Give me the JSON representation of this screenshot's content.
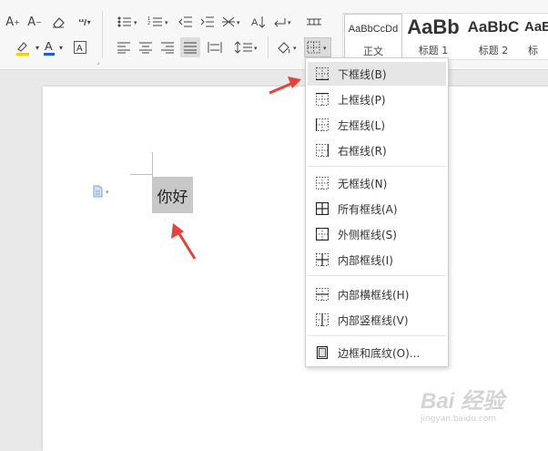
{
  "ribbon": {
    "styles": [
      {
        "sample": "AaBbCcDd",
        "name": "正文"
      },
      {
        "sample": "AaBb",
        "name": "标题 1"
      },
      {
        "sample": "AaBbC",
        "name": "标题 2"
      },
      {
        "sample": "AaBl",
        "name": "标"
      }
    ]
  },
  "document": {
    "cell_text": "你好"
  },
  "border_menu": {
    "items": [
      {
        "label": "下框线(B)",
        "icon": "border-bottom-icon"
      },
      {
        "label": "上框线(P)",
        "icon": "border-top-icon"
      },
      {
        "label": "左框线(L)",
        "icon": "border-left-icon"
      },
      {
        "label": "右框线(R)",
        "icon": "border-right-icon"
      },
      {
        "label": "无框线(N)",
        "icon": "border-none-icon"
      },
      {
        "label": "所有框线(A)",
        "icon": "border-all-icon"
      },
      {
        "label": "外侧框线(S)",
        "icon": "border-outside-icon"
      },
      {
        "label": "内部框线(I)",
        "icon": "border-inside-icon"
      },
      {
        "label": "内部横框线(H)",
        "icon": "border-inside-horizontal-icon"
      },
      {
        "label": "内部竖框线(V)",
        "icon": "border-inside-vertical-icon"
      },
      {
        "label": "边框和底纹(O)...",
        "icon": "borders-and-shading-icon"
      }
    ]
  },
  "watermark": {
    "logo": "Bai 经验",
    "url": "jingyan.baidu.com"
  },
  "colors": {
    "highlight": "#f5d000",
    "font_color": "#1e5bd7",
    "annotation_arrow": "#e8413a"
  }
}
